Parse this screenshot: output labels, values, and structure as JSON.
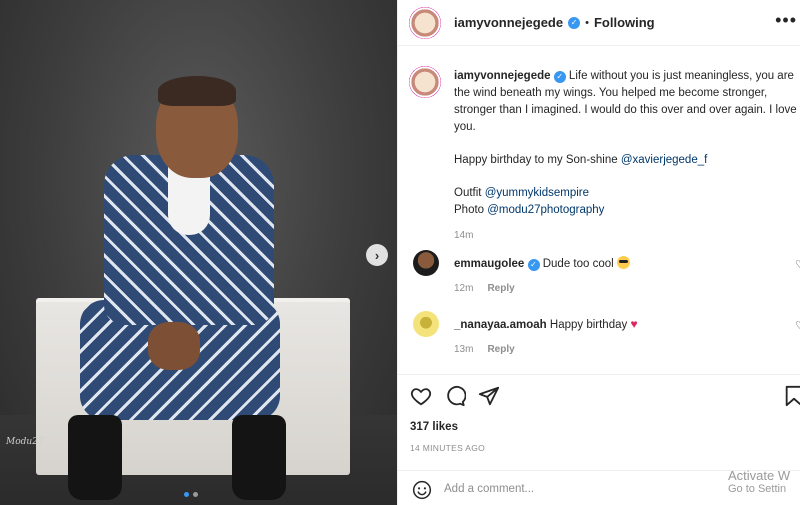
{
  "post": {
    "photo": {
      "watermark": "Modu27",
      "carousel_count": 2,
      "carousel_active": 1
    },
    "header": {
      "username": "iamyvonnejegede",
      "separator": "•",
      "follow_status": "Following"
    },
    "caption": {
      "username": "iamyvonnejegede",
      "text": "Life without you is just meaningless, you are the wind beneath my wings. You helped me become stronger, stronger than I imagined. I would do this over and over again. I love you.",
      "line2_prefix": "Happy birthday to my Son-shine ",
      "line2_mention": "@xavierjegede_f",
      "outfit_label": "Outfit ",
      "outfit_mention": "@yummykidsempire",
      "photo_label": "Photo ",
      "photo_mention": "@modu27photography",
      "time": "14m"
    },
    "comments": [
      {
        "username": "emmaugolee",
        "verified": true,
        "text": "Dude too cool",
        "emoji": "sunglasses-emoji",
        "time": "12m",
        "reply": "Reply"
      },
      {
        "username": "_nanayaa.amoah",
        "verified": false,
        "text": "Happy birthday",
        "emoji": "red-heart-emoji",
        "time": "13m",
        "reply": "Reply"
      }
    ],
    "likes": "317 likes",
    "posted_ago": "14 MINUTES AGO",
    "add_comment": {
      "placeholder": "Add a comment..."
    }
  },
  "os_overlay": {
    "line1": "Activate W",
    "line2": "Go to Settin"
  },
  "colors": {
    "verified": "#3897f0",
    "mention": "#00376b",
    "muted": "#8e8e8e",
    "heart": "#e0245e"
  }
}
